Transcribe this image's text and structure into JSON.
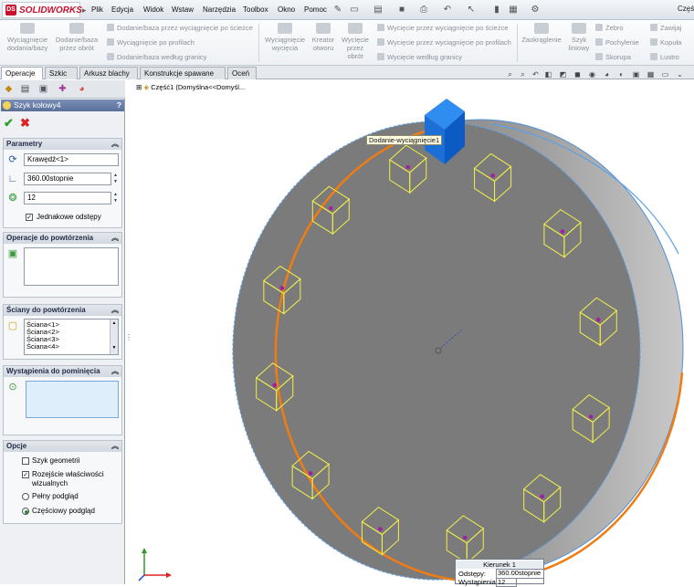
{
  "app": {
    "brand": "SOLIDWORKS",
    "ds": "DS",
    "window_title": "Częś"
  },
  "menu": [
    "Plik",
    "Edycja",
    "Widok",
    "Wstaw",
    "Narzędzia",
    "Toolbox",
    "Okno",
    "Pomoc"
  ],
  "commands": {
    "extrude_boss": "Wyciągnięcie dodania/bazy",
    "revolve_boss": "Dodanie/baza przez obrót",
    "sweep_boss": "Dodanie/baza przez wyciągnięcie po ścieżce",
    "loft_boss": "Wyciągnięcie po profilach",
    "boundary_boss": "Dodanie/baza według granicy",
    "extrude_cut": "Wyciągnięcie wycięcia",
    "hole_wizard": "Kreator otworu",
    "revolve_cut": "Wycięcie przez obrót",
    "sweep_cut": "Wycięcie przez wyciągnięcie po ścieżce",
    "loft_cut": "Wycięcie przez wyciągnięcie po profilach",
    "boundary_cut": "Wycięcie według granicy",
    "fillet": "Zaokrąglenie",
    "linear_pattern": "Szyk liniowy",
    "rib": "Żebro",
    "draft": "Pochylenie",
    "shell": "Skorupa",
    "wrap": "Zawijaj",
    "dome": "Kopuła",
    "mirror": "Lustro"
  },
  "tabs": [
    "Operacje",
    "Szkic",
    "Arkusz blachy",
    "Konstrukcje spawane",
    "Oceń"
  ],
  "feature_tree": {
    "root": "Część1  (Domyślna<<Domyśl..."
  },
  "property_manager": {
    "title": "Szyk kołowy4",
    "help": "?",
    "ok": "✔",
    "cancel": "✖",
    "parameters": {
      "title": "Parametry",
      "axis": "Krawędź<1>",
      "angle": "360.00stopnie",
      "count": "12",
      "equal_spacing": "Jednakowe odstępy"
    },
    "features_to_pattern": {
      "title": "Operacje do powtórzenia"
    },
    "faces_to_pattern": {
      "title": "Ściany do powtórzenia",
      "items": [
        "Ściana<1>",
        "Ściana<2>",
        "Ściana<3>",
        "Ściana<4>"
      ]
    },
    "instances_to_skip": {
      "title": "Wystąpienia do pominięcia"
    },
    "options": {
      "title": "Opcje",
      "geometry_pattern": "Szyk geometrii",
      "propagate_visual": "Rozejście właściwości wizualnych",
      "full_preview": "Pełny podgląd",
      "partial_preview": "Częściowy podgląd"
    }
  },
  "tooltip": "Dodanie-wyciągnięcie1",
  "callout": {
    "title": "Kierunek 1",
    "spacing_label": "Odstępy:",
    "spacing_value": "360.00stopnie",
    "instances_label": "Wystąpienia",
    "instances_value": "12"
  },
  "colors": {
    "face": "#7b7b7b",
    "pattern_preview": "#f2f04a",
    "selected_edge": "#f07c12",
    "highlight_feature": "#1f7fe8",
    "header": "#5a6f99"
  },
  "icons": {
    "checkmark": "checkmark-icon",
    "cancel": "cancel-icon",
    "circular_pattern": "circular-pattern-icon"
  }
}
